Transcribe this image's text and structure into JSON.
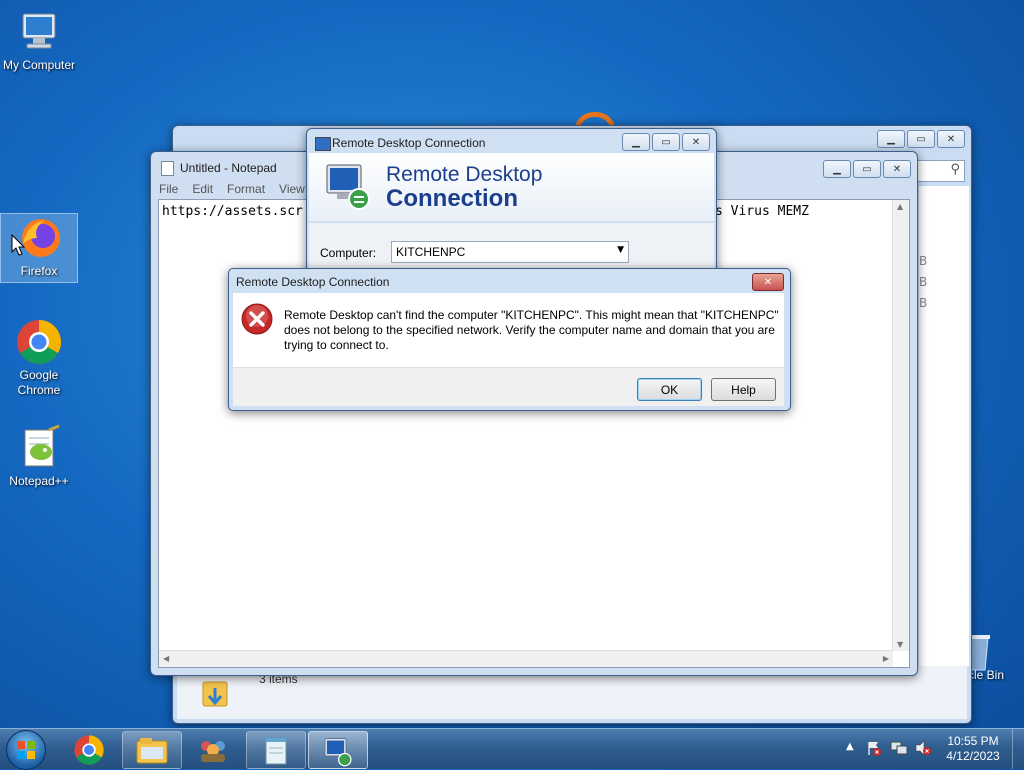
{
  "desktop": {
    "icons": [
      {
        "label": "My Computer"
      },
      {
        "label": "Firefox"
      },
      {
        "label": "Google Chrome"
      },
      {
        "label": "Notepad++"
      },
      {
        "label": "cle Bin"
      }
    ]
  },
  "explorer_window": {
    "status": "3 items",
    "side_partial": [
      "B",
      "B",
      "B"
    ]
  },
  "notepad": {
    "title": "Untitled - Notepad",
    "menu": [
      "File",
      "Edit",
      "Format",
      "View"
    ],
    "content_left": "https://assets.scr",
    "content_right": "s Virus MEMZ"
  },
  "rdc_window": {
    "title": "Remote Desktop Connection",
    "heading_line1": "Remote Desktop",
    "heading_line2": "Connection",
    "computer_label": "Computer:",
    "computer_value": "KITCHENPC"
  },
  "error_dialog": {
    "title": "Remote Desktop Connection",
    "message": "Remote Desktop can't find the computer \"KITCHENPC\". This might mean that \"KITCHENPC\" does not belong to the specified network.  Verify the computer name and domain that you are trying to connect to.",
    "ok_label": "OK",
    "help_label": "Help"
  },
  "taskbar": {
    "time": "10:55 PM",
    "date": "4/12/2023"
  },
  "colors": {
    "heading_blue": "#1b3f8c",
    "error_red": "#c62828"
  }
}
